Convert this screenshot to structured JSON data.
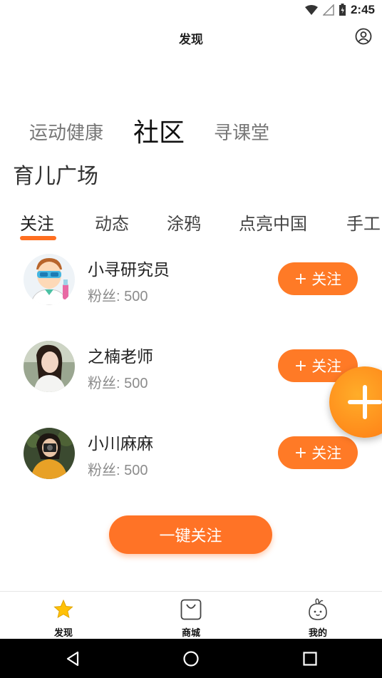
{
  "status_bar": {
    "time": "2:45"
  },
  "header": {
    "title": "发现"
  },
  "segments": [
    {
      "label": "运动健康"
    },
    {
      "label": "社区"
    },
    {
      "label": "寻课堂"
    }
  ],
  "section": {
    "title": "育儿广场"
  },
  "tabs": [
    {
      "label": "关注"
    },
    {
      "label": "动态"
    },
    {
      "label": "涂鸦"
    },
    {
      "label": "点亮中国"
    },
    {
      "label": "手工"
    }
  ],
  "users": [
    {
      "name": "小寻研究员",
      "fans": "粉丝: 500",
      "follow_label": "关注",
      "follow_plus": "+"
    },
    {
      "name": "之楠老师",
      "fans": "粉丝: 500",
      "follow_label": "关注",
      "follow_plus": "+"
    },
    {
      "name": "小川麻麻",
      "fans": "粉丝: 500",
      "follow_label": "关注",
      "follow_plus": "+"
    }
  ],
  "main_button": {
    "label": "一键关注"
  },
  "bottom_nav": [
    {
      "label": "发现"
    },
    {
      "label": "商城"
    },
    {
      "label": "我的"
    }
  ],
  "colors": {
    "accent": "#ff7326",
    "star": "#ffc107"
  },
  "icons": {
    "status": [
      "wifi-icon",
      "signal-icon",
      "battery-icon"
    ],
    "header": "profile-icon",
    "fab": "plus-icon",
    "nav": [
      "star-icon",
      "shopping-bag-icon",
      "mascot-icon"
    ],
    "system": [
      "back-icon",
      "home-icon",
      "recents-icon"
    ]
  }
}
